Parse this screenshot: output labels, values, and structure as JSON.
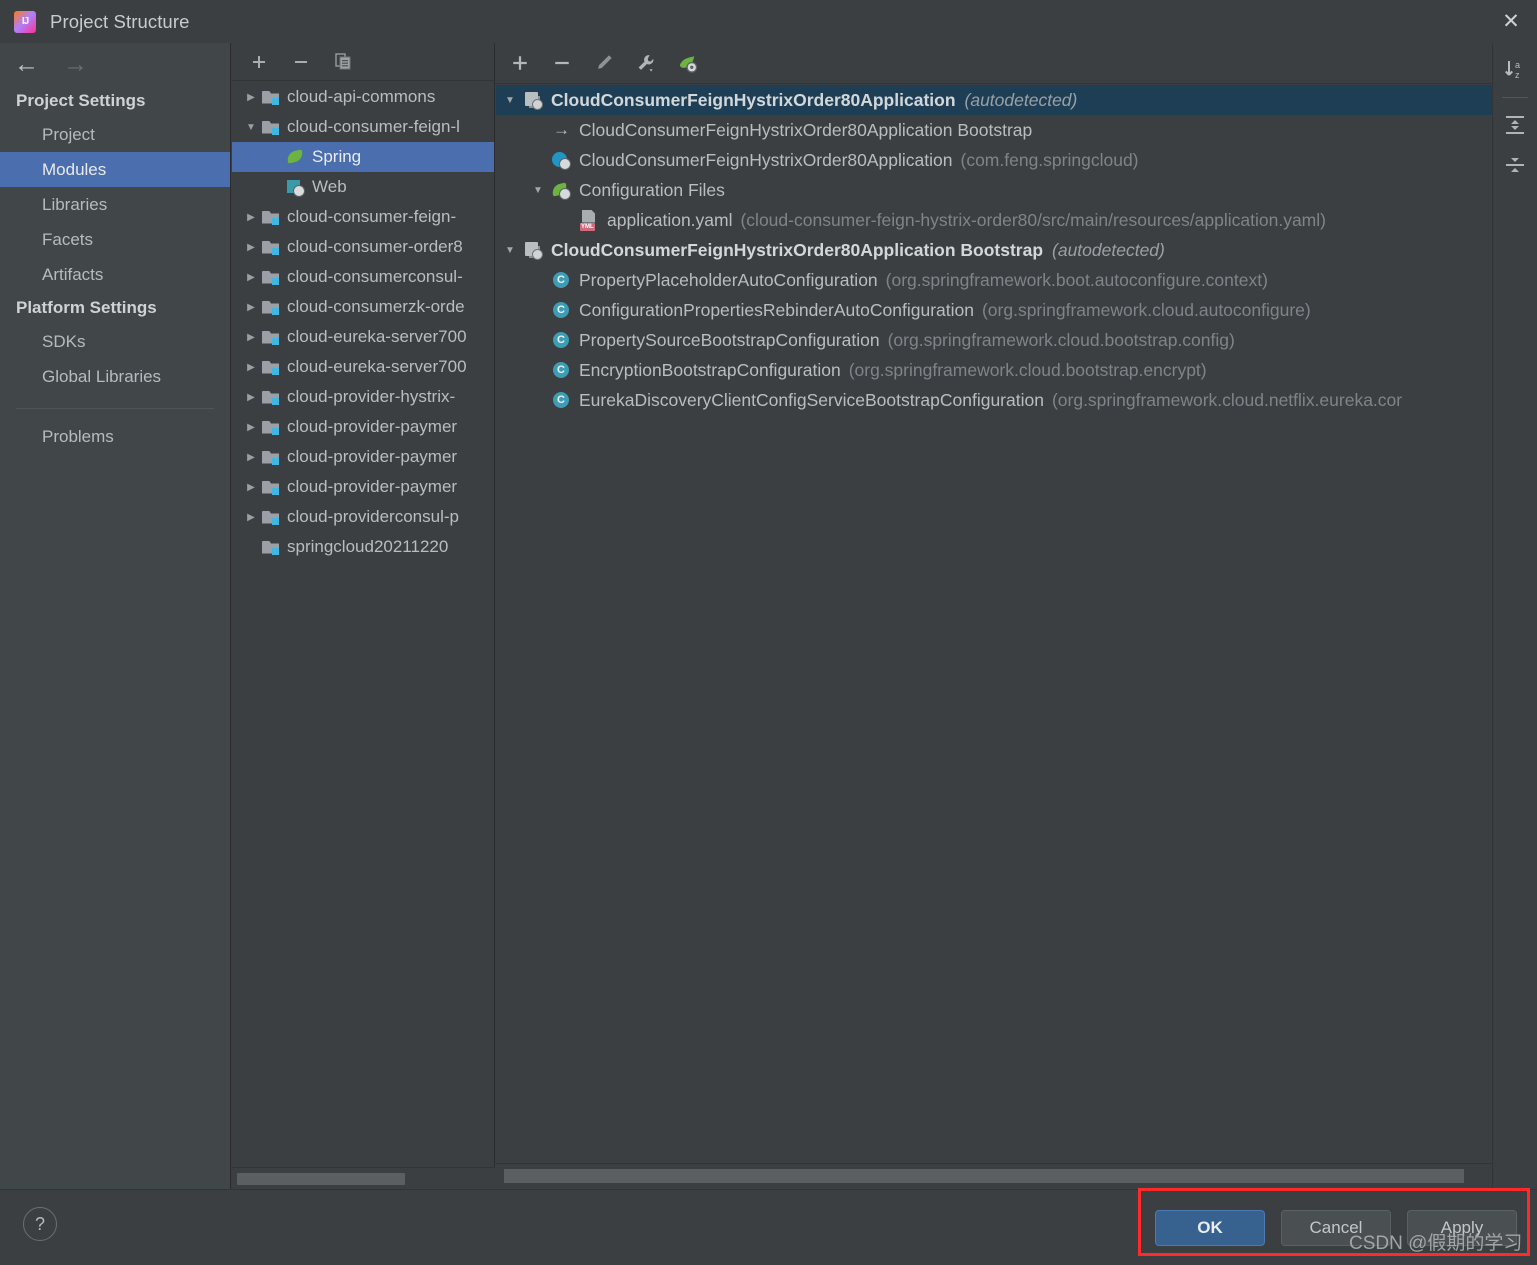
{
  "window": {
    "title": "Project Structure",
    "app_icon": "intellij-idea-icon",
    "close_icon": "close-icon"
  },
  "sidebar": {
    "nav": {
      "back_icon": "arrow-left-icon",
      "forward_icon": "arrow-right-icon"
    },
    "groups": [
      {
        "title": "Project Settings",
        "items": [
          {
            "label": "Project",
            "selected": false
          },
          {
            "label": "Modules",
            "selected": true
          },
          {
            "label": "Libraries",
            "selected": false
          },
          {
            "label": "Facets",
            "selected": false
          },
          {
            "label": "Artifacts",
            "selected": false
          }
        ]
      },
      {
        "title": "Platform Settings",
        "items": [
          {
            "label": "SDKs",
            "selected": false
          },
          {
            "label": "Global Libraries",
            "selected": false
          }
        ]
      }
    ],
    "problems_label": "Problems"
  },
  "modules_panel": {
    "toolbar": [
      {
        "name": "add-module-button",
        "glyph": "+"
      },
      {
        "name": "remove-module-button",
        "glyph": "−"
      },
      {
        "name": "copy-module-button",
        "glyph": "copy-icon"
      }
    ],
    "tree": [
      {
        "label": "cloud-api-commons",
        "icon": "module-icon",
        "twisty": "closed",
        "depth": 0,
        "selected": false
      },
      {
        "label": "cloud-consumer-feign-l",
        "icon": "module-icon",
        "twisty": "open",
        "depth": 0,
        "selected": false
      },
      {
        "label": "Spring",
        "icon": "spring-icon",
        "twisty": "none",
        "depth": 1,
        "selected": true
      },
      {
        "label": "Web",
        "icon": "web-icon",
        "twisty": "none",
        "depth": 1,
        "selected": false
      },
      {
        "label": "cloud-consumer-feign-",
        "icon": "module-icon",
        "twisty": "closed",
        "depth": 0,
        "selected": false
      },
      {
        "label": "cloud-consumer-order8",
        "icon": "module-icon",
        "twisty": "closed",
        "depth": 0,
        "selected": false
      },
      {
        "label": "cloud-consumerconsul-",
        "icon": "module-icon",
        "twisty": "closed",
        "depth": 0,
        "selected": false
      },
      {
        "label": "cloud-consumerzk-orde",
        "icon": "module-icon",
        "twisty": "closed",
        "depth": 0,
        "selected": false
      },
      {
        "label": "cloud-eureka-server700",
        "icon": "module-icon",
        "twisty": "closed",
        "depth": 0,
        "selected": false
      },
      {
        "label": "cloud-eureka-server700",
        "icon": "module-icon",
        "twisty": "closed",
        "depth": 0,
        "selected": false
      },
      {
        "label": "cloud-provider-hystrix-",
        "icon": "module-icon",
        "twisty": "closed",
        "depth": 0,
        "selected": false
      },
      {
        "label": "cloud-provider-paymer",
        "icon": "module-icon",
        "twisty": "closed",
        "depth": 0,
        "selected": false
      },
      {
        "label": "cloud-provider-paymer",
        "icon": "module-icon",
        "twisty": "closed",
        "depth": 0,
        "selected": false
      },
      {
        "label": "cloud-provider-paymer",
        "icon": "module-icon",
        "twisty": "closed",
        "depth": 0,
        "selected": false
      },
      {
        "label": "cloud-providerconsul-p",
        "icon": "module-icon",
        "twisty": "closed",
        "depth": 0,
        "selected": false
      },
      {
        "label": "springcloud20211220",
        "icon": "module-icon",
        "twisty": "none",
        "depth": 0,
        "selected": false
      }
    ]
  },
  "detail_panel": {
    "toolbar": [
      {
        "name": "add-facet-button",
        "glyph": "+"
      },
      {
        "name": "remove-facet-button",
        "glyph": "−"
      },
      {
        "name": "edit-facet-button",
        "glyph": "pencil-icon"
      },
      {
        "name": "settings-facet-button",
        "glyph": "wrench-icon"
      },
      {
        "name": "spring-facet-button",
        "glyph": "spring-leaf-icon"
      }
    ],
    "tree": [
      {
        "icon": "spring-context-icon",
        "twisty": "open",
        "depth": 0,
        "selected": true,
        "label": "CloudConsumerFeignHystrixOrder80Application",
        "bold": true,
        "italic_suffix": "(autodetected)",
        "dim_suffix": ""
      },
      {
        "icon": "arrow-right-icon",
        "twisty": "blank",
        "depth": 1,
        "selected": false,
        "label": "CloudConsumerFeignHystrixOrder80Application Bootstrap",
        "bold": false,
        "italic_suffix": "",
        "dim_suffix": ""
      },
      {
        "icon": "spring-boot-icon",
        "twisty": "blank",
        "depth": 1,
        "selected": false,
        "label": "CloudConsumerFeignHystrixOrder80Application",
        "bold": false,
        "italic_suffix": "",
        "dim_suffix": "(com.feng.springcloud)"
      },
      {
        "icon": "spring-config-files-icon",
        "twisty": "open",
        "depth": 1,
        "selected": false,
        "label": "Configuration Files",
        "bold": false,
        "italic_suffix": "",
        "dim_suffix": ""
      },
      {
        "icon": "yaml-file-icon",
        "twisty": "blank",
        "depth": 2,
        "selected": false,
        "label": "application.yaml",
        "bold": false,
        "italic_suffix": "",
        "dim_suffix": "(cloud-consumer-feign-hystrix-order80/src/main/resources/application.yaml)"
      },
      {
        "icon": "spring-context-icon",
        "twisty": "open",
        "depth": 0,
        "selected": false,
        "label": "CloudConsumerFeignHystrixOrder80Application Bootstrap",
        "bold": true,
        "italic_suffix": "(autodetected)",
        "dim_suffix": ""
      },
      {
        "icon": "class-icon",
        "twisty": "blank",
        "depth": 1,
        "selected": false,
        "label": "PropertyPlaceholderAutoConfiguration",
        "bold": false,
        "italic_suffix": "",
        "dim_suffix": "(org.springframework.boot.autoconfigure.context)"
      },
      {
        "icon": "class-icon",
        "twisty": "blank",
        "depth": 1,
        "selected": false,
        "label": "ConfigurationPropertiesRebinderAutoConfiguration",
        "bold": false,
        "italic_suffix": "",
        "dim_suffix": "(org.springframework.cloud.autoconfigure)"
      },
      {
        "icon": "class-icon",
        "twisty": "blank",
        "depth": 1,
        "selected": false,
        "label": "PropertySourceBootstrapConfiguration",
        "bold": false,
        "italic_suffix": "",
        "dim_suffix": "(org.springframework.cloud.bootstrap.config)"
      },
      {
        "icon": "class-icon",
        "twisty": "blank",
        "depth": 1,
        "selected": false,
        "label": "EncryptionBootstrapConfiguration",
        "bold": false,
        "italic_suffix": "",
        "dim_suffix": "(org.springframework.cloud.bootstrap.encrypt)"
      },
      {
        "icon": "class-icon",
        "twisty": "blank",
        "depth": 1,
        "selected": false,
        "label": "EurekaDiscoveryClientConfigServiceBootstrapConfiguration",
        "bold": false,
        "italic_suffix": "",
        "dim_suffix": "(org.springframework.cloud.netflix.eureka.cor"
      }
    ]
  },
  "vertical_toolbar": [
    {
      "name": "sort-alphabetically-icon",
      "label": "a↓z"
    },
    {
      "name": "expand-all-icon",
      "label": "expand"
    },
    {
      "name": "collapse-all-icon",
      "label": "collapse"
    }
  ],
  "footer": {
    "help_label": "?",
    "buttons": [
      {
        "label": "OK",
        "primary": true
      },
      {
        "label": "Cancel",
        "primary": false
      },
      {
        "label": "Apply",
        "primary": false
      }
    ]
  },
  "watermark": "CSDN @假期的学习",
  "colors": {
    "selection_blue": "#4b6eaf",
    "selection_navy": "#1e3e55",
    "panel_bg": "#3c3f41",
    "sidebar_bg": "#414649",
    "highlight_red": "#ff2b2b",
    "spring_green": "#6db33f",
    "class_teal": "#3c9db5"
  }
}
